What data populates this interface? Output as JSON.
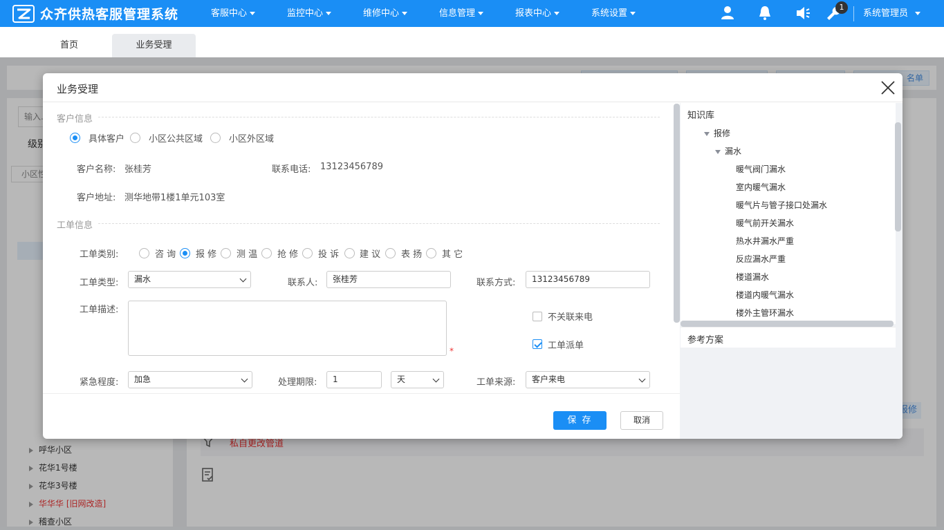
{
  "topbar": {
    "app_title": "众齐供热客服管理系统",
    "nav": [
      "客服中心",
      "监控中心",
      "维修中心",
      "信息管理",
      "报表中心",
      "系统设置"
    ],
    "icons": [
      "user-icon",
      "bell-icon",
      "speaker-icon",
      "wrench-icon"
    ],
    "badge": "1",
    "user": "系统管理员"
  },
  "tabs": {
    "home": "首页",
    "business": "业务受理"
  },
  "background": {
    "search_placeholder": "输入...",
    "level_label": "级别",
    "select_text": "小区性",
    "tree": [
      "呼华小区",
      "花华1号楼",
      "花华3号楼",
      "华华华 [旧网改造]",
      "稽查小区"
    ],
    "alert_text": "私自更改管道",
    "btn_right1": "名单",
    "btn_right2": "报修"
  },
  "modal": {
    "title": "业务受理",
    "customer": {
      "legend": "客户信息",
      "types": [
        "具体客户",
        "小区公共区域",
        "小区外区域"
      ],
      "selected": 0,
      "name_label": "客户名称:",
      "name": "张桂芳",
      "phone_label": "联系电话:",
      "phone": "13123456789",
      "address_label": "客户地址:",
      "address": "测华地带1楼1单元103室"
    },
    "order": {
      "legend": "工单信息",
      "category_label": "工单类别:",
      "categories": [
        "咨 询",
        "报 修",
        "测 温",
        "抢 修",
        "投 诉",
        "建 议",
        "表 扬",
        "其 它"
      ],
      "category_selected": 1,
      "type_label": "工单类型:",
      "type_value": "漏水",
      "contact_label": "联系人:",
      "contact_value": "张桂芳",
      "method_label": "联系方式:",
      "method_value": "13123456789",
      "desc_label": "工单描述:",
      "desc_value": "",
      "required_mark": "*",
      "no_link_label": "不关联来电",
      "no_link_checked": false,
      "dispatch_label": "工单派单",
      "dispatch_checked": true,
      "urgency_label": "紧急程度:",
      "urgency_value": "加急",
      "deadline_label": "处理期限:",
      "deadline_value": "1",
      "deadline_unit": "天",
      "source_label": "工单来源:",
      "source_value": "客户来电"
    },
    "buttons": {
      "save": "保 存",
      "cancel": "取消"
    },
    "knowledge": {
      "title": "知识库",
      "root": "报修",
      "group": "漏水",
      "items": [
        "暖气阀门漏水",
        "室内暖气漏水",
        "暖气片与管子接口处漏水",
        "暖气前开关漏水",
        "热水井漏水严重",
        "反应漏水严重",
        "楼道漏水",
        "楼道内暖气漏水",
        "楼外主管环漏水"
      ]
    },
    "reference": {
      "title": "参考方案"
    }
  },
  "colors": {
    "primary": "#1a8ef5",
    "danger": "#e33"
  }
}
